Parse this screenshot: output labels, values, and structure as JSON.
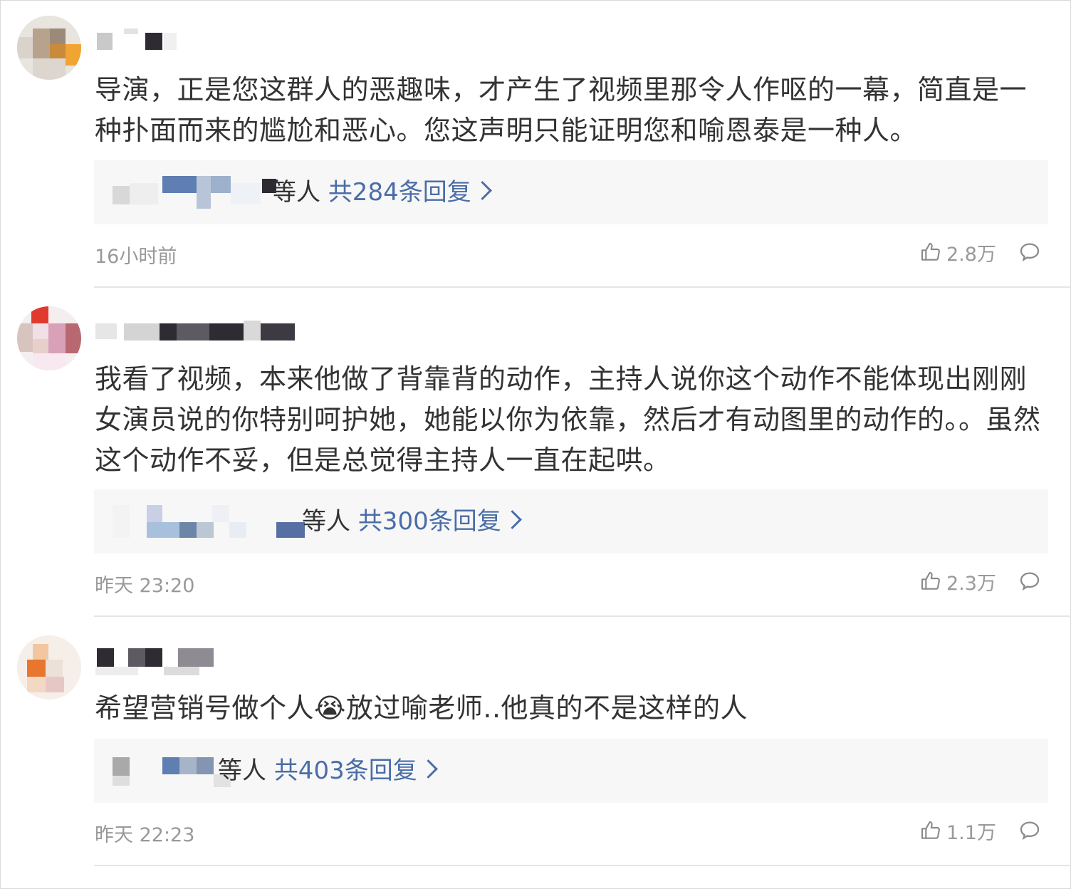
{
  "comments": [
    {
      "text": "导演，正是您这群人的恶趣味，才产生了视频里那令人作呕的一幕，简直是一种扑面而来的尴尬和恶心。您这声明只能证明您和喻恩泰是一种人。",
      "reply_suffix": "等人",
      "reply_total": "共284条回复",
      "time": "16小时前",
      "likes": "2.8万"
    },
    {
      "text": "我看了视频，本来他做了背靠背的动作，主持人说你这个动作不能体现出刚刚女演员说的你特别呵护她，她能以你为依靠，然后才有动图里的动作的。。虽然这个动作不妥，但是总觉得主持人一直在起哄。",
      "reply_suffix": "等人",
      "reply_total": "共300条回复",
      "time": "昨天 23:20",
      "likes": "2.3万"
    },
    {
      "text": "希望营销号做个人😭放过喻老师..他真的不是这样的人",
      "reply_suffix": "等人",
      "reply_total": "共403条回复",
      "time": "昨天 22:23",
      "likes": "1.1万"
    }
  ],
  "icons": {
    "like": "thumbs-up-icon",
    "reply": "speech-bubble-icon",
    "more": "chevron-right-icon"
  },
  "colors": {
    "link": "#4a6da7",
    "meta": "#999999",
    "reply_bg": "#f7f7f7",
    "divider": "#e5e5e5"
  }
}
